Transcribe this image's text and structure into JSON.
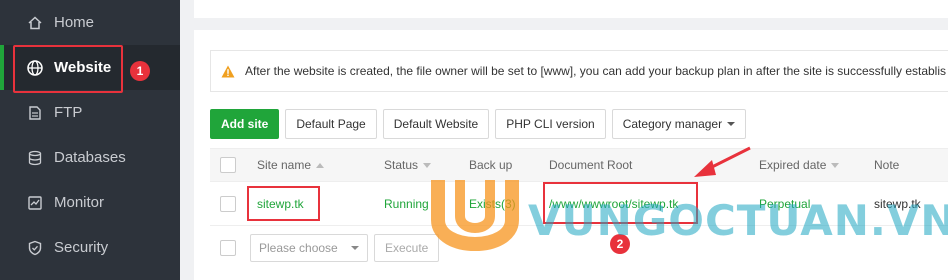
{
  "sidebar": {
    "items": [
      {
        "label": "Home",
        "icon": "home-icon"
      },
      {
        "label": "Website",
        "icon": "globe-icon",
        "active": true
      },
      {
        "label": "FTP",
        "icon": "ftp-icon"
      },
      {
        "label": "Databases",
        "icon": "database-icon"
      },
      {
        "label": "Monitor",
        "icon": "monitor-icon"
      },
      {
        "label": "Security",
        "icon": "shield-icon"
      }
    ]
  },
  "annotations": {
    "step1": "1",
    "step2": "2"
  },
  "notice": {
    "text": "After the website is created, the file owner will be set to [www], you can add your backup plan in after the site is successfully establis"
  },
  "toolbar": {
    "add_site": "Add site",
    "default_page": "Default Page",
    "default_website": "Default Website",
    "php_cli": "PHP CLI version",
    "category_manager": "Category manager"
  },
  "table": {
    "headers": {
      "site_name": "Site name",
      "status": "Status",
      "backup": "Back up",
      "document_root": "Document Root",
      "expired_date": "Expired date",
      "note": "Note"
    },
    "rows": [
      {
        "site_name": "sitewp.tk",
        "status": "Running",
        "backup": "Exists(3)",
        "document_root": "/www/wwwroot/sitewp.tk",
        "expired_date": "Perpetual",
        "note": "sitewp.tk"
      }
    ]
  },
  "footer": {
    "select_placeholder": "Please choose",
    "execute": "Execute"
  },
  "watermark": {
    "text": "VUNGOCTUAN.VN"
  },
  "colors": {
    "sidebar_bg": "#2d333b",
    "accent_green": "#20a53a",
    "annotation_red": "#e8323c",
    "watermark_blue": "#1fa7c2",
    "watermark_orange": "#f7941d"
  }
}
